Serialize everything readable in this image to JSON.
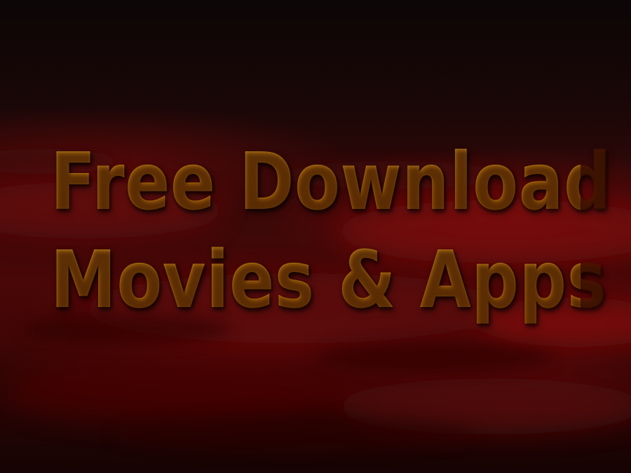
{
  "banner": {
    "line1": "Free Download",
    "line2": "Movies & Apps"
  },
  "colors": {
    "text": "#f4b81c",
    "background_dark": "#0b0505",
    "background_red": "#4a0707"
  }
}
